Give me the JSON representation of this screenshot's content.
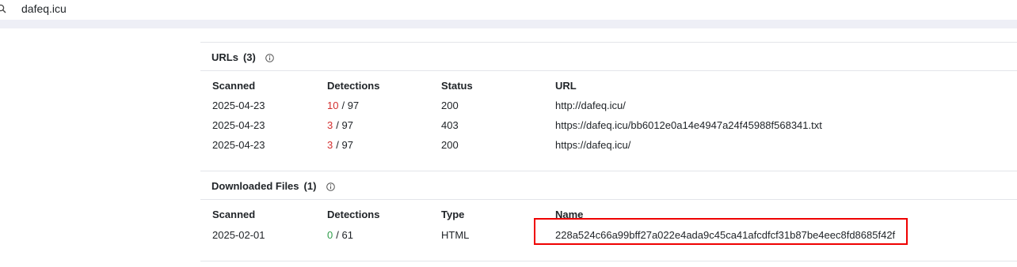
{
  "search": {
    "query": "dafeq.icu",
    "icon": "search-icon"
  },
  "urls": {
    "title": "URLs",
    "count": "(3)",
    "columns": [
      "Scanned",
      "Detections",
      "Status",
      "URL"
    ],
    "rows": [
      {
        "scanned": "2025-04-23",
        "detections": "10",
        "total": "/ 97",
        "status": "200",
        "url": "http://dafeq.icu/"
      },
      {
        "scanned": "2025-04-23",
        "detections": "3",
        "total": "/ 97",
        "status": "403",
        "url": "https://dafeq.icu/bb6012e0a14e4947a24f45988f568341.txt"
      },
      {
        "scanned": "2025-04-23",
        "detections": "3",
        "total": "/ 97",
        "status": "200",
        "url": "https://dafeq.icu/"
      }
    ]
  },
  "files": {
    "title": "Downloaded Files",
    "count": "(1)",
    "columns": [
      "Scanned",
      "Detections",
      "Type",
      "Name"
    ],
    "rows": [
      {
        "scanned": "2025-02-01",
        "detections": "0",
        "total": "/ 61",
        "type": "HTML",
        "name": "228a524c66a99bff27a022e4ada9c45ca41afcdfcf31b87be4eec8fd8685f42f"
      }
    ]
  },
  "colors": {
    "malicious": "#d32f2f",
    "clean": "#2e9d4a",
    "highlight": "#ef0000"
  }
}
